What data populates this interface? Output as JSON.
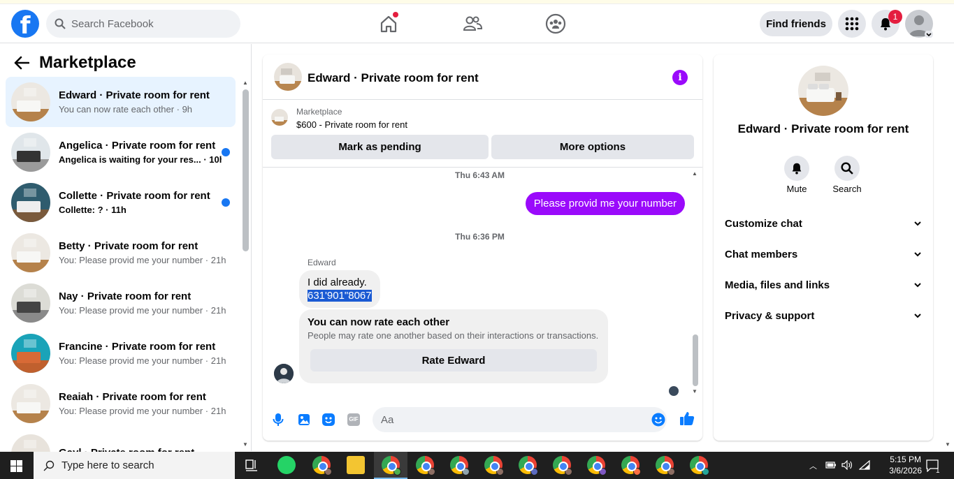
{
  "header": {
    "search_placeholder": "Search Facebook",
    "find_friends": "Find friends",
    "notifications_count": "1"
  },
  "sidebar": {
    "title": "Marketplace",
    "conversations": [
      {
        "name": "Edward · Private room for rent",
        "preview": "You can now rate each other",
        "time": "9h",
        "unread": false,
        "active": true
      },
      {
        "name": "Angelica · Private room for rent",
        "preview": "Angelica is waiting for your res...",
        "time": "10h",
        "unread": true,
        "active": false
      },
      {
        "name": "Collette · Private room for rent",
        "preview": "Collette: ?",
        "time": "11h",
        "unread": true,
        "active": false
      },
      {
        "name": "Betty · Private room for rent",
        "preview": "You: Please provid me your number",
        "time": "21h",
        "unread": false,
        "active": false
      },
      {
        "name": "Nay · Private room for rent",
        "preview": "You: Please provid me your number",
        "time": "21h",
        "unread": false,
        "active": false
      },
      {
        "name": "Francine · Private room for rent",
        "preview": "You: Please provid me your number",
        "time": "21h",
        "unread": false,
        "active": false
      },
      {
        "name": "Reaiah · Private room for rent",
        "preview": "You: Please provid me your number",
        "time": "21h",
        "unread": false,
        "active": false
      },
      {
        "name": "Gayl · Private room for rent",
        "preview": "",
        "time": "",
        "unread": false,
        "active": false
      }
    ]
  },
  "chat": {
    "title": "Edward · Private room for rent",
    "listing_source": "Marketplace",
    "listing_title": "$600 - Private room for rent",
    "mark_pending": "Mark as pending",
    "more_options": "More options",
    "time1": "Thu 6:43 AM",
    "outgoing_msg": "Please provid me your number",
    "time2": "Thu 6:36 PM",
    "sender": "Edward",
    "incoming_line1": "I did already.",
    "incoming_line2": "631'901\"8067",
    "rate_title": "You can now rate each other",
    "rate_desc": "People may rate one another based on their interactions or transactions.",
    "rate_button": "Rate Edward",
    "composer_placeholder": "Aa"
  },
  "details": {
    "title": "Edward · Private room for rent",
    "mute": "Mute",
    "search": "Search",
    "rows": [
      "Customize chat",
      "Chat members",
      "Media, files and links",
      "Privacy & support"
    ]
  },
  "taskbar": {
    "search_placeholder": "Type here to search",
    "time": "5:15 PM",
    "date": "3/6/2026",
    "notif_count": "1"
  },
  "colors": {
    "brand": "#1877f2",
    "messenger_purple": "#9a0afb",
    "selection": "#1a5ad3"
  }
}
